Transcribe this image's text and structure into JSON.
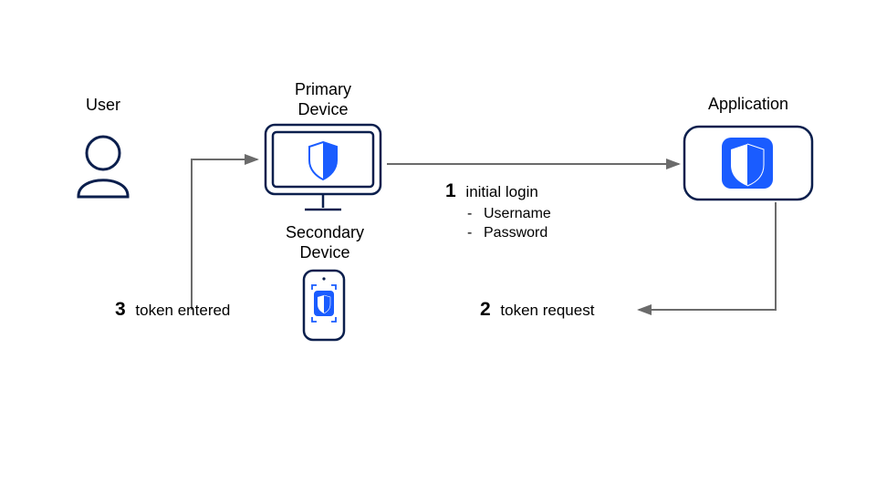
{
  "nodes": {
    "user": {
      "label": "User"
    },
    "primary": {
      "label_l1": "Primary",
      "label_l2": "Device"
    },
    "secondary": {
      "label_l1": "Secondary",
      "label_l2": "Device"
    },
    "application": {
      "label": "Application"
    }
  },
  "steps": {
    "s1": {
      "num": "1",
      "text": "initial login",
      "items": [
        "Username",
        "Password"
      ]
    },
    "s2": {
      "num": "2",
      "text": "token request"
    },
    "s3": {
      "num": "3",
      "text": "token entered"
    }
  },
  "colors": {
    "navy": "#0b1f4d",
    "blue": "#1a5cff",
    "arrow": "#6b6b6b"
  }
}
